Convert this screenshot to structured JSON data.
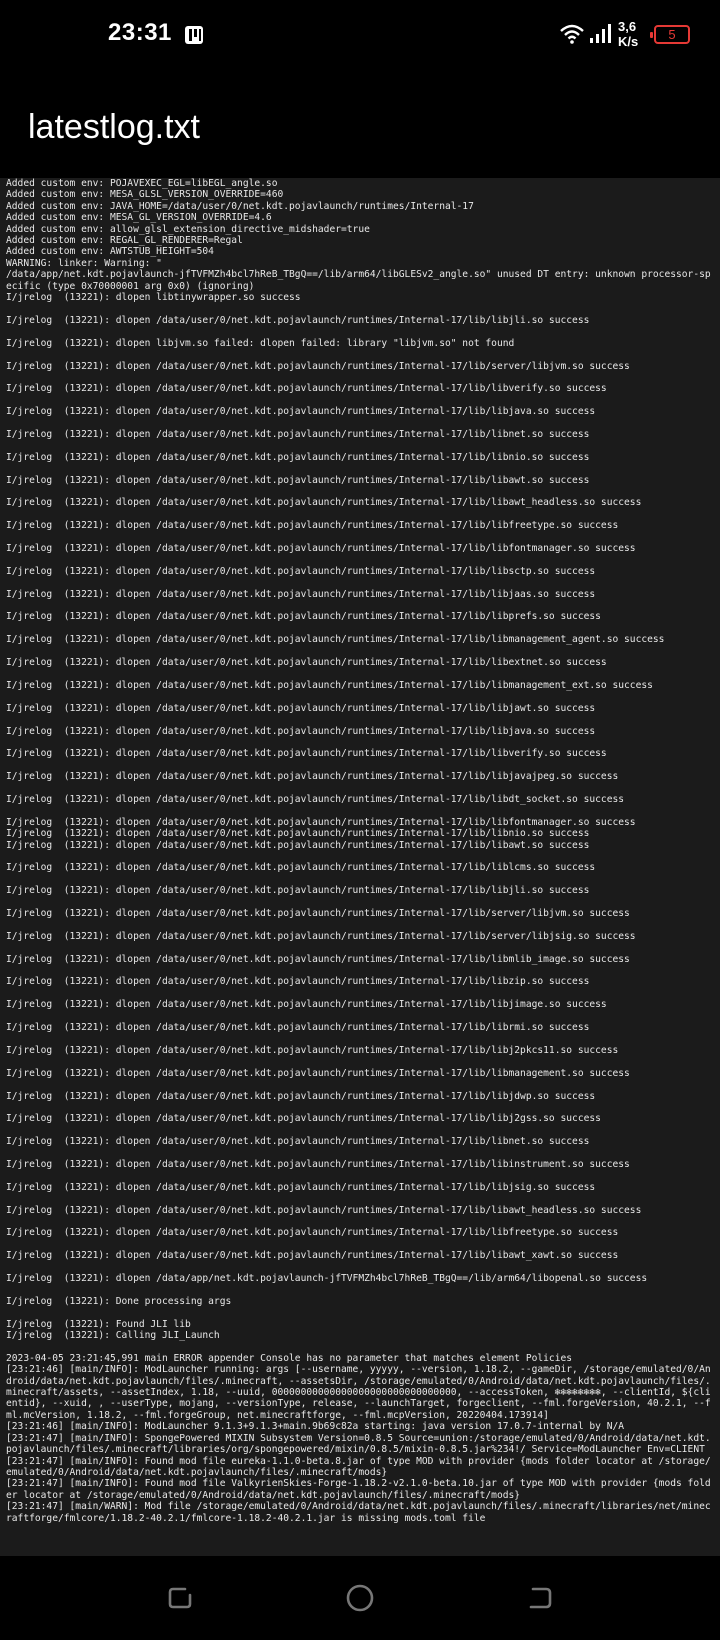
{
  "status_bar": {
    "time": "23:31",
    "network_speed_value": "3,6",
    "network_speed_unit": "K/s",
    "battery_level": "5",
    "icons": [
      "notification-p-icon",
      "wifi-icon",
      "signal-icon",
      "battery-icon"
    ],
    "battery_color": "#e53935"
  },
  "header": {
    "title": "latestlog.txt"
  },
  "log": {
    "text": "Added custom env: POJAVEXEC_EGL=libEGL_angle.so\nAdded custom env: MESA_GLSL_VERSION_OVERRIDE=460\nAdded custom env: JAVA_HOME=/data/user/0/net.kdt.pojavlaunch/runtimes/Internal-17\nAdded custom env: MESA_GL_VERSION_OVERRIDE=4.6\nAdded custom env: allow_glsl_extension_directive_midshader=true\nAdded custom env: REGAL_GL_RENDERER=Regal\nAdded custom env: AWTSTUB_HEIGHT=504\nWARNING: linker: Warning: \"\n/data/app/net.kdt.pojavlaunch-jfTVFMZh4bcl7hReB_TBgQ==/lib/arm64/libGLESv2_angle.so\" unused DT entry: unknown processor-specific (type 0x70000001 arg 0x0) (ignoring)\nI/jrelog  (13221): dlopen libtinywrapper.so success\n\nI/jrelog  (13221): dlopen /data/user/0/net.kdt.pojavlaunch/runtimes/Internal-17/lib/libjli.so success\n\nI/jrelog  (13221): dlopen libjvm.so failed: dlopen failed: library \"libjvm.so\" not found\n\nI/jrelog  (13221): dlopen /data/user/0/net.kdt.pojavlaunch/runtimes/Internal-17/lib/server/libjvm.so success\n\nI/jrelog  (13221): dlopen /data/user/0/net.kdt.pojavlaunch/runtimes/Internal-17/lib/libverify.so success\n\nI/jrelog  (13221): dlopen /data/user/0/net.kdt.pojavlaunch/runtimes/Internal-17/lib/libjava.so success\n\nI/jrelog  (13221): dlopen /data/user/0/net.kdt.pojavlaunch/runtimes/Internal-17/lib/libnet.so success\n\nI/jrelog  (13221): dlopen /data/user/0/net.kdt.pojavlaunch/runtimes/Internal-17/lib/libnio.so success\n\nI/jrelog  (13221): dlopen /data/user/0/net.kdt.pojavlaunch/runtimes/Internal-17/lib/libawt.so success\n\nI/jrelog  (13221): dlopen /data/user/0/net.kdt.pojavlaunch/runtimes/Internal-17/lib/libawt_headless.so success\n\nI/jrelog  (13221): dlopen /data/user/0/net.kdt.pojavlaunch/runtimes/Internal-17/lib/libfreetype.so success\n\nI/jrelog  (13221): dlopen /data/user/0/net.kdt.pojavlaunch/runtimes/Internal-17/lib/libfontmanager.so success\n\nI/jrelog  (13221): dlopen /data/user/0/net.kdt.pojavlaunch/runtimes/Internal-17/lib/libsctp.so success\n\nI/jrelog  (13221): dlopen /data/user/0/net.kdt.pojavlaunch/runtimes/Internal-17/lib/libjaas.so success\n\nI/jrelog  (13221): dlopen /data/user/0/net.kdt.pojavlaunch/runtimes/Internal-17/lib/libprefs.so success\n\nI/jrelog  (13221): dlopen /data/user/0/net.kdt.pojavlaunch/runtimes/Internal-17/lib/libmanagement_agent.so success\n\nI/jrelog  (13221): dlopen /data/user/0/net.kdt.pojavlaunch/runtimes/Internal-17/lib/libextnet.so success\n\nI/jrelog  (13221): dlopen /data/user/0/net.kdt.pojavlaunch/runtimes/Internal-17/lib/libmanagement_ext.so success\n\nI/jrelog  (13221): dlopen /data/user/0/net.kdt.pojavlaunch/runtimes/Internal-17/lib/libjawt.so success\n\nI/jrelog  (13221): dlopen /data/user/0/net.kdt.pojavlaunch/runtimes/Internal-17/lib/libjava.so success\n\nI/jrelog  (13221): dlopen /data/user/0/net.kdt.pojavlaunch/runtimes/Internal-17/lib/libverify.so success\n\nI/jrelog  (13221): dlopen /data/user/0/net.kdt.pojavlaunch/runtimes/Internal-17/lib/libjavajpeg.so success\n\nI/jrelog  (13221): dlopen /data/user/0/net.kdt.pojavlaunch/runtimes/Internal-17/lib/libdt_socket.so success\n\nI/jrelog  (13221): dlopen /data/user/0/net.kdt.pojavlaunch/runtimes/Internal-17/lib/libfontmanager.so success\nI/jrelog  (13221): dlopen /data/user/0/net.kdt.pojavlaunch/runtimes/Internal-17/lib/libnio.so success\nI/jrelog  (13221): dlopen /data/user/0/net.kdt.pojavlaunch/runtimes/Internal-17/lib/libawt.so success\n\nI/jrelog  (13221): dlopen /data/user/0/net.kdt.pojavlaunch/runtimes/Internal-17/lib/liblcms.so success\n\nI/jrelog  (13221): dlopen /data/user/0/net.kdt.pojavlaunch/runtimes/Internal-17/lib/libjli.so success\n\nI/jrelog  (13221): dlopen /data/user/0/net.kdt.pojavlaunch/runtimes/Internal-17/lib/server/libjvm.so success\n\nI/jrelog  (13221): dlopen /data/user/0/net.kdt.pojavlaunch/runtimes/Internal-17/lib/server/libjsig.so success\n\nI/jrelog  (13221): dlopen /data/user/0/net.kdt.pojavlaunch/runtimes/Internal-17/lib/libmlib_image.so success\n\nI/jrelog  (13221): dlopen /data/user/0/net.kdt.pojavlaunch/runtimes/Internal-17/lib/libzip.so success\n\nI/jrelog  (13221): dlopen /data/user/0/net.kdt.pojavlaunch/runtimes/Internal-17/lib/libjimage.so success\n\nI/jrelog  (13221): dlopen /data/user/0/net.kdt.pojavlaunch/runtimes/Internal-17/lib/librmi.so success\n\nI/jrelog  (13221): dlopen /data/user/0/net.kdt.pojavlaunch/runtimes/Internal-17/lib/libj2pkcs11.so success\n\nI/jrelog  (13221): dlopen /data/user/0/net.kdt.pojavlaunch/runtimes/Internal-17/lib/libmanagement.so success\n\nI/jrelog  (13221): dlopen /data/user/0/net.kdt.pojavlaunch/runtimes/Internal-17/lib/libjdwp.so success\n\nI/jrelog  (13221): dlopen /data/user/0/net.kdt.pojavlaunch/runtimes/Internal-17/lib/libj2gss.so success\n\nI/jrelog  (13221): dlopen /data/user/0/net.kdt.pojavlaunch/runtimes/Internal-17/lib/libnet.so success\n\nI/jrelog  (13221): dlopen /data/user/0/net.kdt.pojavlaunch/runtimes/Internal-17/lib/libinstrument.so success\n\nI/jrelog  (13221): dlopen /data/user/0/net.kdt.pojavlaunch/runtimes/Internal-17/lib/libjsig.so success\n\nI/jrelog  (13221): dlopen /data/user/0/net.kdt.pojavlaunch/runtimes/Internal-17/lib/libawt_headless.so success\n\nI/jrelog  (13221): dlopen /data/user/0/net.kdt.pojavlaunch/runtimes/Internal-17/lib/libfreetype.so success\n\nI/jrelog  (13221): dlopen /data/user/0/net.kdt.pojavlaunch/runtimes/Internal-17/lib/libawt_xawt.so success\n\nI/jrelog  (13221): dlopen /data/app/net.kdt.pojavlaunch-jfTVFMZh4bcl7hReB_TBgQ==/lib/arm64/libopenal.so success\n\nI/jrelog  (13221): Done processing args\n\nI/jrelog  (13221): Found JLI lib\nI/jrelog  (13221): Calling JLI_Launch\n\n2023-04-05 23:21:45,991 main ERROR appender Console has no parameter that matches element Policies\n[23:21:46] [main/INFO]: ModLauncher running: args [--username, yyyyy, --version, 1.18.2, --gameDir, /storage/emulated/0/Android/data/net.kdt.pojavlaunch/files/.minecraft, --assetsDir, /storage/emulated/0/Android/data/net.kdt.pojavlaunch/files/.minecraft/assets, --assetIndex, 1.18, --uuid, 00000000000000000000000000000000, --accessToken, ❄❄❄❄❄❄❄❄, --clientId, ${clientid}, --xuid, , --userType, mojang, --versionType, release, --launchTarget, forgeclient, --fml.forgeVersion, 40.2.1, --fml.mcVersion, 1.18.2, --fml.forgeGroup, net.minecraftforge, --fml.mcpVersion, 20220404.173914]\n[23:21:46] [main/INFO]: ModLauncher 9.1.3+9.1.3+main.9b69c82a starting: java version 17.0.7-internal by N/A\n[23:21:47] [main/INFO]: SpongePowered MIXIN Subsystem Version=0.8.5 Source=union:/storage/emulated/0/Android/data/net.kdt.pojavlaunch/files/.minecraft/libraries/org/spongepowered/mixin/0.8.5/mixin-0.8.5.jar%234!/ Service=ModLauncher Env=CLIENT\n[23:21:47] [main/INFO]: Found mod file eureka-1.1.0-beta.8.jar of type MOD with provider {mods folder locator at /storage/emulated/0/Android/data/net.kdt.pojavlaunch/files/.minecraft/mods}\n[23:21:47] [main/INFO]: Found mod file ValkyrienSkies-Forge-1.18.2-v2.1.0-beta.10.jar of type MOD with provider {mods folder locator at /storage/emulated/0/Android/data/net.kdt.pojavlaunch/files/.minecraft/mods}\n[23:21:47] [main/WARN]: Mod file /storage/emulated/0/Android/data/net.kdt.pojavlaunch/files/.minecraft/libraries/net/minecraftforge/fmlcore/1.18.2-40.2.1/fmlcore-1.18.2-40.2.1.jar is missing mods.toml file"
  },
  "nav_bar": {
    "icons": [
      "recent-apps-icon",
      "home-icon",
      "back-icon"
    ]
  }
}
